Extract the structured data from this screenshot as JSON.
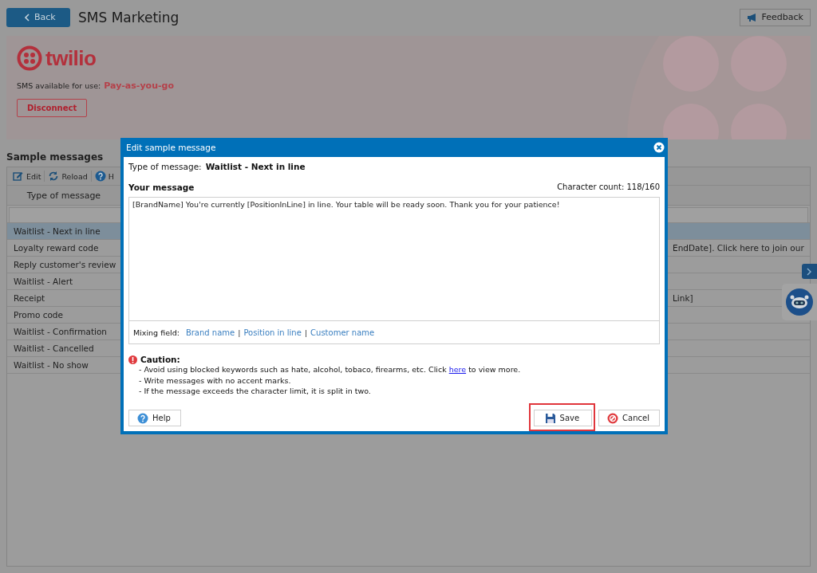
{
  "header": {
    "back": "Back",
    "title": "SMS Marketing",
    "feedback": "Feedback"
  },
  "banner": {
    "logo_text": "twilio",
    "sms_label": "SMS available for use:",
    "sms_plan": "Pay-as-you-go",
    "disconnect": "Disconnect"
  },
  "sample_messages": {
    "title": "Sample messages",
    "toolbar": [
      "Edit",
      "Reload",
      "H"
    ],
    "columns": [
      "Type of message"
    ],
    "rows": [
      {
        "type": "Waitlist - Next in line",
        "selected": true
      },
      {
        "type": "Loyalty reward code",
        "message": "EndDate]. Click here to join our",
        "selected": false
      },
      {
        "type": "Reply customer's review",
        "selected": false
      },
      {
        "type": "Waitlist - Alert",
        "selected": false
      },
      {
        "type": "Receipt",
        "message": "Link]",
        "selected": false
      },
      {
        "type": "Promo code",
        "selected": false
      },
      {
        "type": "Waitlist - Confirmation",
        "selected": false
      },
      {
        "type": "Waitlist - Cancelled",
        "selected": false
      },
      {
        "type": "Waitlist - No show",
        "selected": false
      }
    ]
  },
  "dialog": {
    "title": "Edit sample message",
    "type_label": "Type of message:",
    "type_value": "Waitlist - Next in line",
    "message_label": "Your message",
    "char_count": "Character count: 118/160",
    "message": "[BrandName] You're currently [PositionInLine] in line. Your table will be ready soon. Thank you for your patience!",
    "mixing_label": "Mixing field:",
    "mixing_links": [
      "Brand name",
      "Position in line",
      "Customer name"
    ],
    "separator": "|",
    "caution_title": "Caution:",
    "caution_lines": [
      {
        "text": "- Avoid using blocked keywords such as hate, alcohol, tobaco, firearms, etc. Click ",
        "link": "here",
        "after": " to view more."
      },
      {
        "text": "- Write messages with no accent marks."
      },
      {
        "text": "- If the message exceeds the character limit, it is split in two."
      }
    ],
    "buttons": [
      {
        "label": "Help",
        "kind": "help",
        "highlighted": false
      },
      {
        "label": "Save",
        "kind": "save",
        "highlighted": true
      },
      {
        "label": "Cancel",
        "kind": "cancel",
        "highlighted": false
      }
    ]
  }
}
